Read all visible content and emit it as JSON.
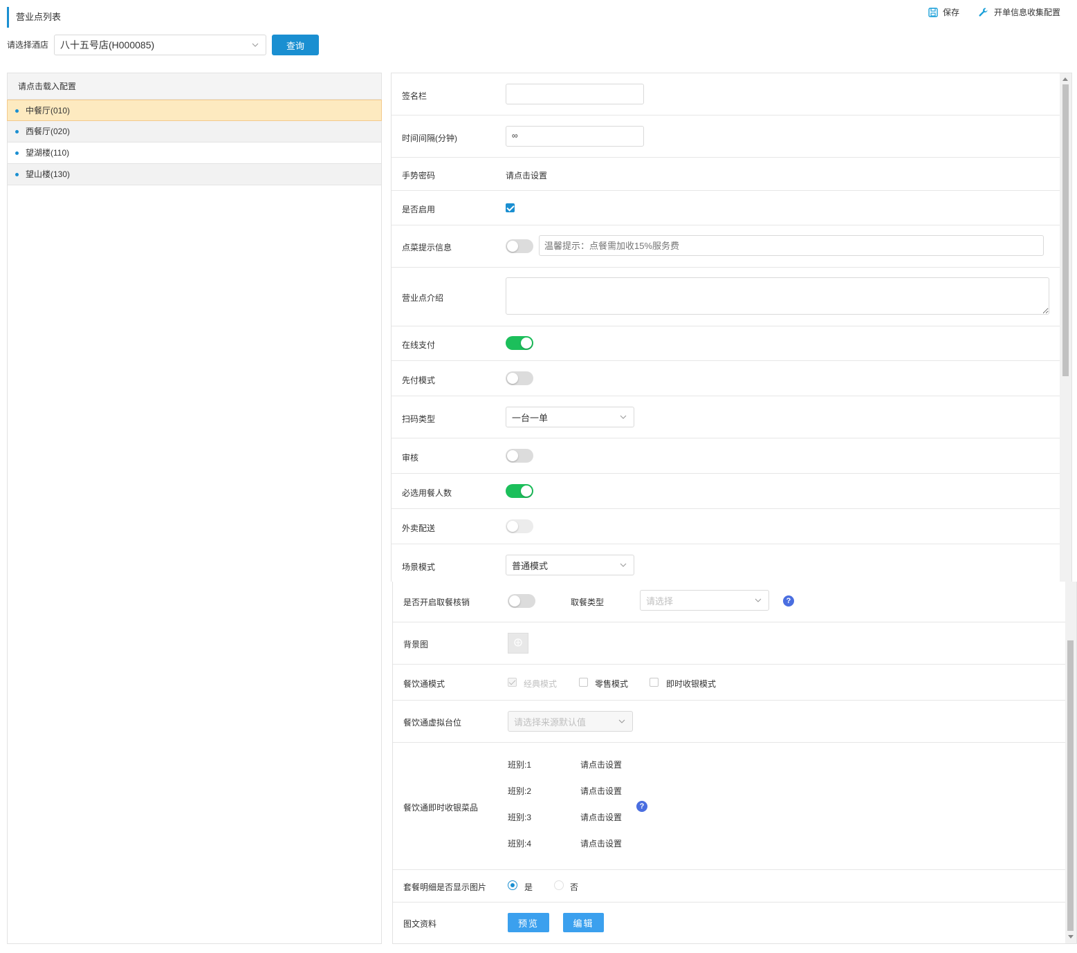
{
  "header": {
    "title": "营业点列表",
    "save_label": "保存",
    "config_label": "开单信息收集配置"
  },
  "filter": {
    "hotel_label": "请选择酒店",
    "hotel_value": "八十五号店(H000085)",
    "query_label": "查询"
  },
  "outlets": {
    "header": "请点击载入配置",
    "items": [
      {
        "label": "中餐厅(010)"
      },
      {
        "label": "西餐厅(020)"
      },
      {
        "label": "望湖楼(110)"
      },
      {
        "label": "望山楼(130)"
      }
    ]
  },
  "config": {
    "signature_label": "签名栏",
    "signature_value": "",
    "interval_label": "时间间隔(分钟)",
    "interval_value": "∞",
    "gesture_label": "手势密码",
    "gesture_value": "请点击设置",
    "enabled_label": "是否启用",
    "enabled": true,
    "tip_label": "点菜提示信息",
    "tip_enabled": false,
    "tip_placeholder": "温馨提示：点餐需加收15%服务费",
    "intro_label": "营业点介绍",
    "intro_value": "",
    "online_pay_label": "在线支付",
    "online_pay": true,
    "prepay_label": "先付模式",
    "prepay": false,
    "scan_type_label": "扫码类型",
    "scan_type_value": "一台一单",
    "audit_label": "审核",
    "audit": false,
    "guest_count_label": "必选用餐人数",
    "guest_count": true,
    "delivery_label": "外卖配送",
    "delivery": false,
    "scene_label": "场景模式",
    "scene_value": "普通模式",
    "pickup_label": "是否开启取餐核销",
    "pickup": false,
    "pickup_type_label": "取餐类型",
    "pickup_type_placeholder": "请选择",
    "bg_label": "背景图",
    "cyt_mode_label": "餐饮通模式",
    "cyt_modes": [
      {
        "label": "经典模式",
        "checked": true,
        "disabled": true
      },
      {
        "label": "零售模式",
        "checked": false,
        "disabled": false
      },
      {
        "label": "即时收银模式",
        "checked": false,
        "disabled": false
      }
    ],
    "cyt_table_label": "餐饮通虚拟台位",
    "cyt_table_placeholder": "请选择来源默认值",
    "cyt_dishes_label": "餐饮通即时收银菜品",
    "shifts": [
      {
        "label": "班别:1",
        "value": "请点击设置"
      },
      {
        "label": "班别:2",
        "value": "请点击设置"
      },
      {
        "label": "班别:3",
        "value": "请点击设置"
      },
      {
        "label": "班别:4",
        "value": "请点击设置"
      }
    ],
    "combo_img_label": "套餐明细是否显示图片",
    "combo_yes": "是",
    "combo_no": "否",
    "combo_value": "是",
    "media_label": "图文资料",
    "preview_label": "预览",
    "edit_label": "编辑"
  },
  "colors": {
    "accent": "#1a8fd1",
    "toggle_on": "#1cbf5b",
    "selected_row": "#fdeac0"
  }
}
